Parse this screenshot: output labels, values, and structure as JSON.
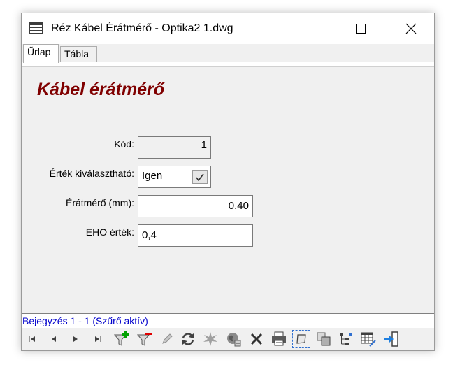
{
  "window": {
    "title": "Réz Kábel Érátmérő - Optika2 1.dwg"
  },
  "tabs": [
    {
      "label": "Űrlap",
      "active": true
    },
    {
      "label": "Tábla",
      "active": false
    }
  ],
  "form": {
    "heading": "Kábel érátmérő",
    "fields": {
      "kod": {
        "label": "Kód:",
        "value": "1"
      },
      "ertek_kivalaszthato": {
        "label": "Érték kiválasztható:",
        "value": "Igen",
        "checked": true
      },
      "eratmero": {
        "label": "Érátmérő (mm):",
        "value": "0.40"
      },
      "eho_ertek": {
        "label": "EHO érték:",
        "value": "0,4"
      }
    }
  },
  "status": {
    "text": "Bejegyzés 1 - 1 (Szűrő aktív)",
    "color": "#0000cc"
  },
  "toolbar": {
    "icons": [
      "first-record-icon",
      "previous-record-icon",
      "next-record-icon",
      "last-record-icon",
      "add-filter-icon",
      "remove-filter-icon",
      "edit-pencil-icon",
      "refresh-icon",
      "highlight-star-icon",
      "zoom-globe-icon",
      "delete-x-icon",
      "print-icon",
      "select-object-icon",
      "copy-objects-icon",
      "link-tree-icon",
      "table-edit-icon",
      "exit-icon"
    ]
  },
  "colors": {
    "heading": "#800000",
    "panel": "#f0f0f0",
    "status": "#0000cc"
  }
}
